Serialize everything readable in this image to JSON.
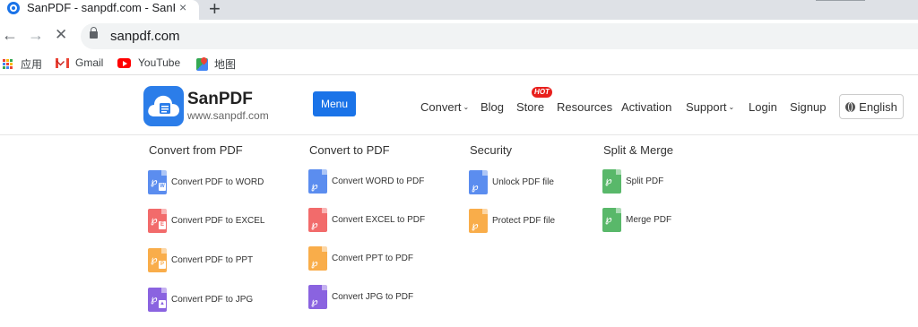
{
  "browser": {
    "tab_title": "SanPDF - sanpdf.com - SanPDF",
    "tab_close": "×",
    "new_tab": "+",
    "url": "sanpdf.com",
    "back": "←",
    "forward": "→",
    "stop": "✕",
    "bookmarks": [
      {
        "label": "应用"
      },
      {
        "label": "Gmail"
      },
      {
        "label": "YouTube"
      },
      {
        "label": "地图"
      }
    ],
    "apps_colors": [
      "#ea4335",
      "#fbbc04",
      "#34a853",
      "#4285f4",
      "#ea4335",
      "#fbbc04",
      "#34a853",
      "#4285f4",
      "#ea4335"
    ]
  },
  "site": {
    "brand_name": "SanPDF",
    "brand_url": "www.sanpdf.com",
    "menu_label": "Menu",
    "nav": {
      "convert": "Convert",
      "blog": "Blog",
      "store": "Store",
      "hot": "HOT",
      "resources": "Resources",
      "activation": "Activation",
      "support": "Support",
      "login": "Login",
      "signup": "Signup",
      "language": "English"
    },
    "accent_color": "#1a73e8"
  },
  "dropdown": {
    "convert_from_pdf": {
      "title": "Convert from PDF",
      "items": [
        {
          "label": "Convert PDF to WORD",
          "color": "#5b8def",
          "tag": "W"
        },
        {
          "label": "Convert PDF to EXCEL",
          "color": "#f26b6b",
          "tag": "E"
        },
        {
          "label": "Convert PDF to PPT",
          "color": "#f9ad4a",
          "tag": "P"
        },
        {
          "label": "Convert PDF to JPG",
          "color": "#8a63e0",
          "tag": "▲"
        }
      ]
    },
    "convert_to_pdf": {
      "title": "Convert to PDF",
      "items": [
        {
          "label": "Convert WORD to PDF",
          "color": "#5b8def"
        },
        {
          "label": "Convert EXCEL to PDF",
          "color": "#f26b6b"
        },
        {
          "label": "Convert PPT to PDF",
          "color": "#f9ad4a"
        },
        {
          "label": "Convert JPG to PDF",
          "color": "#8a63e0"
        }
      ]
    },
    "security": {
      "title": "Security",
      "items": [
        {
          "label": "Unlock PDF file",
          "color": "#5b8def"
        },
        {
          "label": "Protect PDF file",
          "color": "#f9ad4a"
        }
      ]
    },
    "split_merge": {
      "title": "Split & Merge",
      "items": [
        {
          "label": "Split PDF",
          "color": "#59b86a"
        },
        {
          "label": "Merge PDF",
          "color": "#59b86a"
        }
      ]
    }
  }
}
